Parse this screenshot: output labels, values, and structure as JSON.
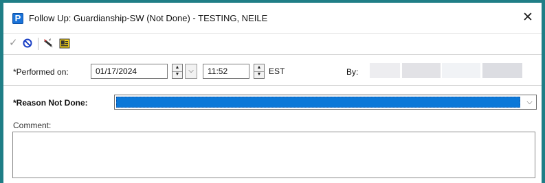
{
  "window": {
    "app_icon_letter": "P",
    "title": "Follow Up: Guardianship-SW (Not Done) - TESTING, NEILE",
    "close_glyph": "✕",
    "frame_color": "#1f7e86"
  },
  "toolbar": {
    "check_icon": "checkmark-icon",
    "cancel_icon": "cancel-icon",
    "tool1_icon": "pen-tool-icon",
    "tool2_icon": "document-icon"
  },
  "performed": {
    "label": "*Performed on:",
    "date": "01/17/2024",
    "time": "11:52",
    "timezone": "EST",
    "by_label": "By:"
  },
  "reason": {
    "label": "*Reason Not Done:",
    "selected_value": "",
    "highlight_color": "#0b78d8"
  },
  "comment": {
    "label": "Comment:",
    "value": ""
  }
}
